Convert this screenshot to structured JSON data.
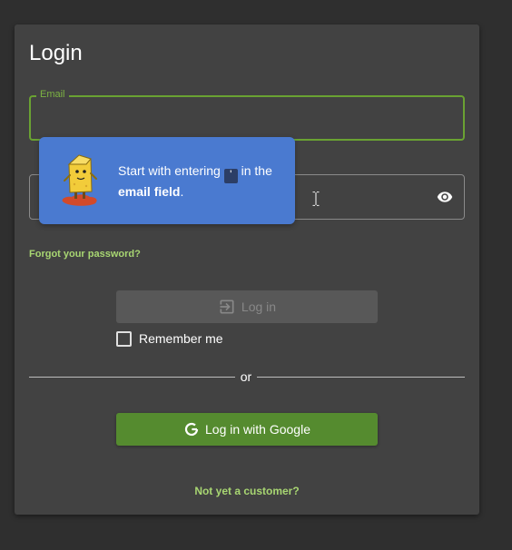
{
  "login": {
    "title": "Login",
    "email": {
      "label": "Email",
      "value": ""
    },
    "password": {
      "value": ""
    },
    "forgot_password": "Forgot your password?",
    "login_button": "Log in",
    "remember_me": "Remember me",
    "divider": "or",
    "google_button": "Log in with Google",
    "signup_link": "Not yet a customer?"
  },
  "tooltip": {
    "text_before": "Start with entering",
    "key_glyph": "'",
    "text_middle": "in the",
    "text_bold": "email field",
    "text_after": "."
  },
  "colors": {
    "page_background": "#2f2f2f",
    "card_background": "#424242",
    "accent_green": "#6aa232",
    "link_green": "#a8d672",
    "google_button": "#558b2f",
    "disabled_button": "#585858",
    "tooltip_blue": "#4a7ad0"
  },
  "icons": {
    "password_toggle": "eye-icon",
    "login": "login-arrow-icon",
    "google": "google-g-icon",
    "mascot": "mascot-character-icon",
    "cursor": "text-cursor-icon"
  }
}
